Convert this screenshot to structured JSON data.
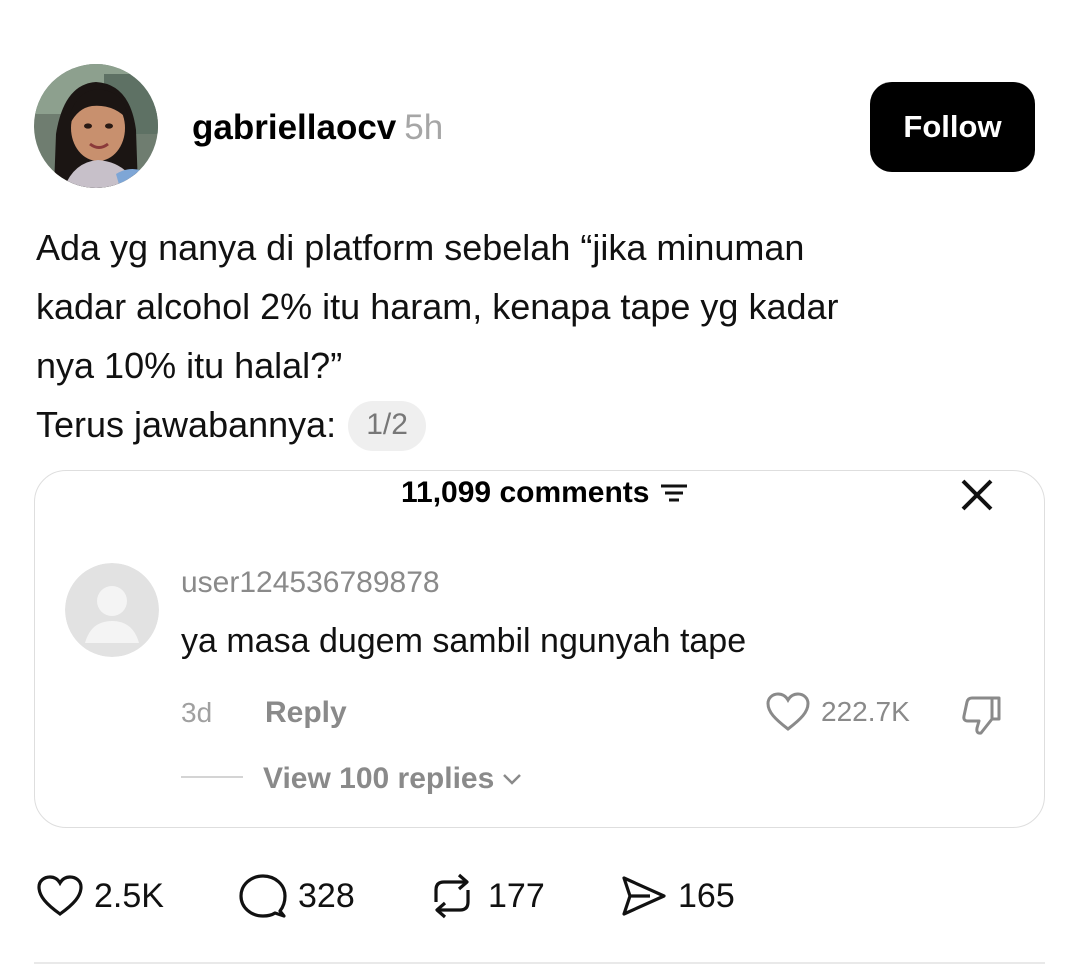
{
  "post": {
    "username": "gabriellaocv",
    "time": "5h",
    "follow_label": "Follow",
    "text_lines": [
      "Ada yg nanya di platform sebelah “jika minuman",
      "kadar alcohol 2% itu haram, kenapa tape yg kadar",
      "nya 10% itu halal?”",
      "Terus jawabannya:"
    ],
    "pager": "1/2"
  },
  "embedded": {
    "comments_count": "11,099 comments",
    "comment": {
      "username": "user124536789878",
      "text": "ya masa dugem sambil ngunyah tape",
      "time": "3d",
      "reply_label": "Reply",
      "likes": "222.7K",
      "view_replies": "View 100 replies"
    }
  },
  "actions": {
    "likes": "2.5K",
    "comments": "328",
    "reposts": "177",
    "shares": "165"
  },
  "icons": [
    "avatar-photo",
    "filter-icon",
    "close-icon",
    "heart-icon",
    "dislike-icon",
    "chevron-down-icon",
    "comment-icon",
    "repost-icon",
    "send-icon"
  ],
  "colors": {
    "follow_bg": "#000000",
    "muted": "#8a8a8a",
    "pager_bg": "#efefef"
  }
}
